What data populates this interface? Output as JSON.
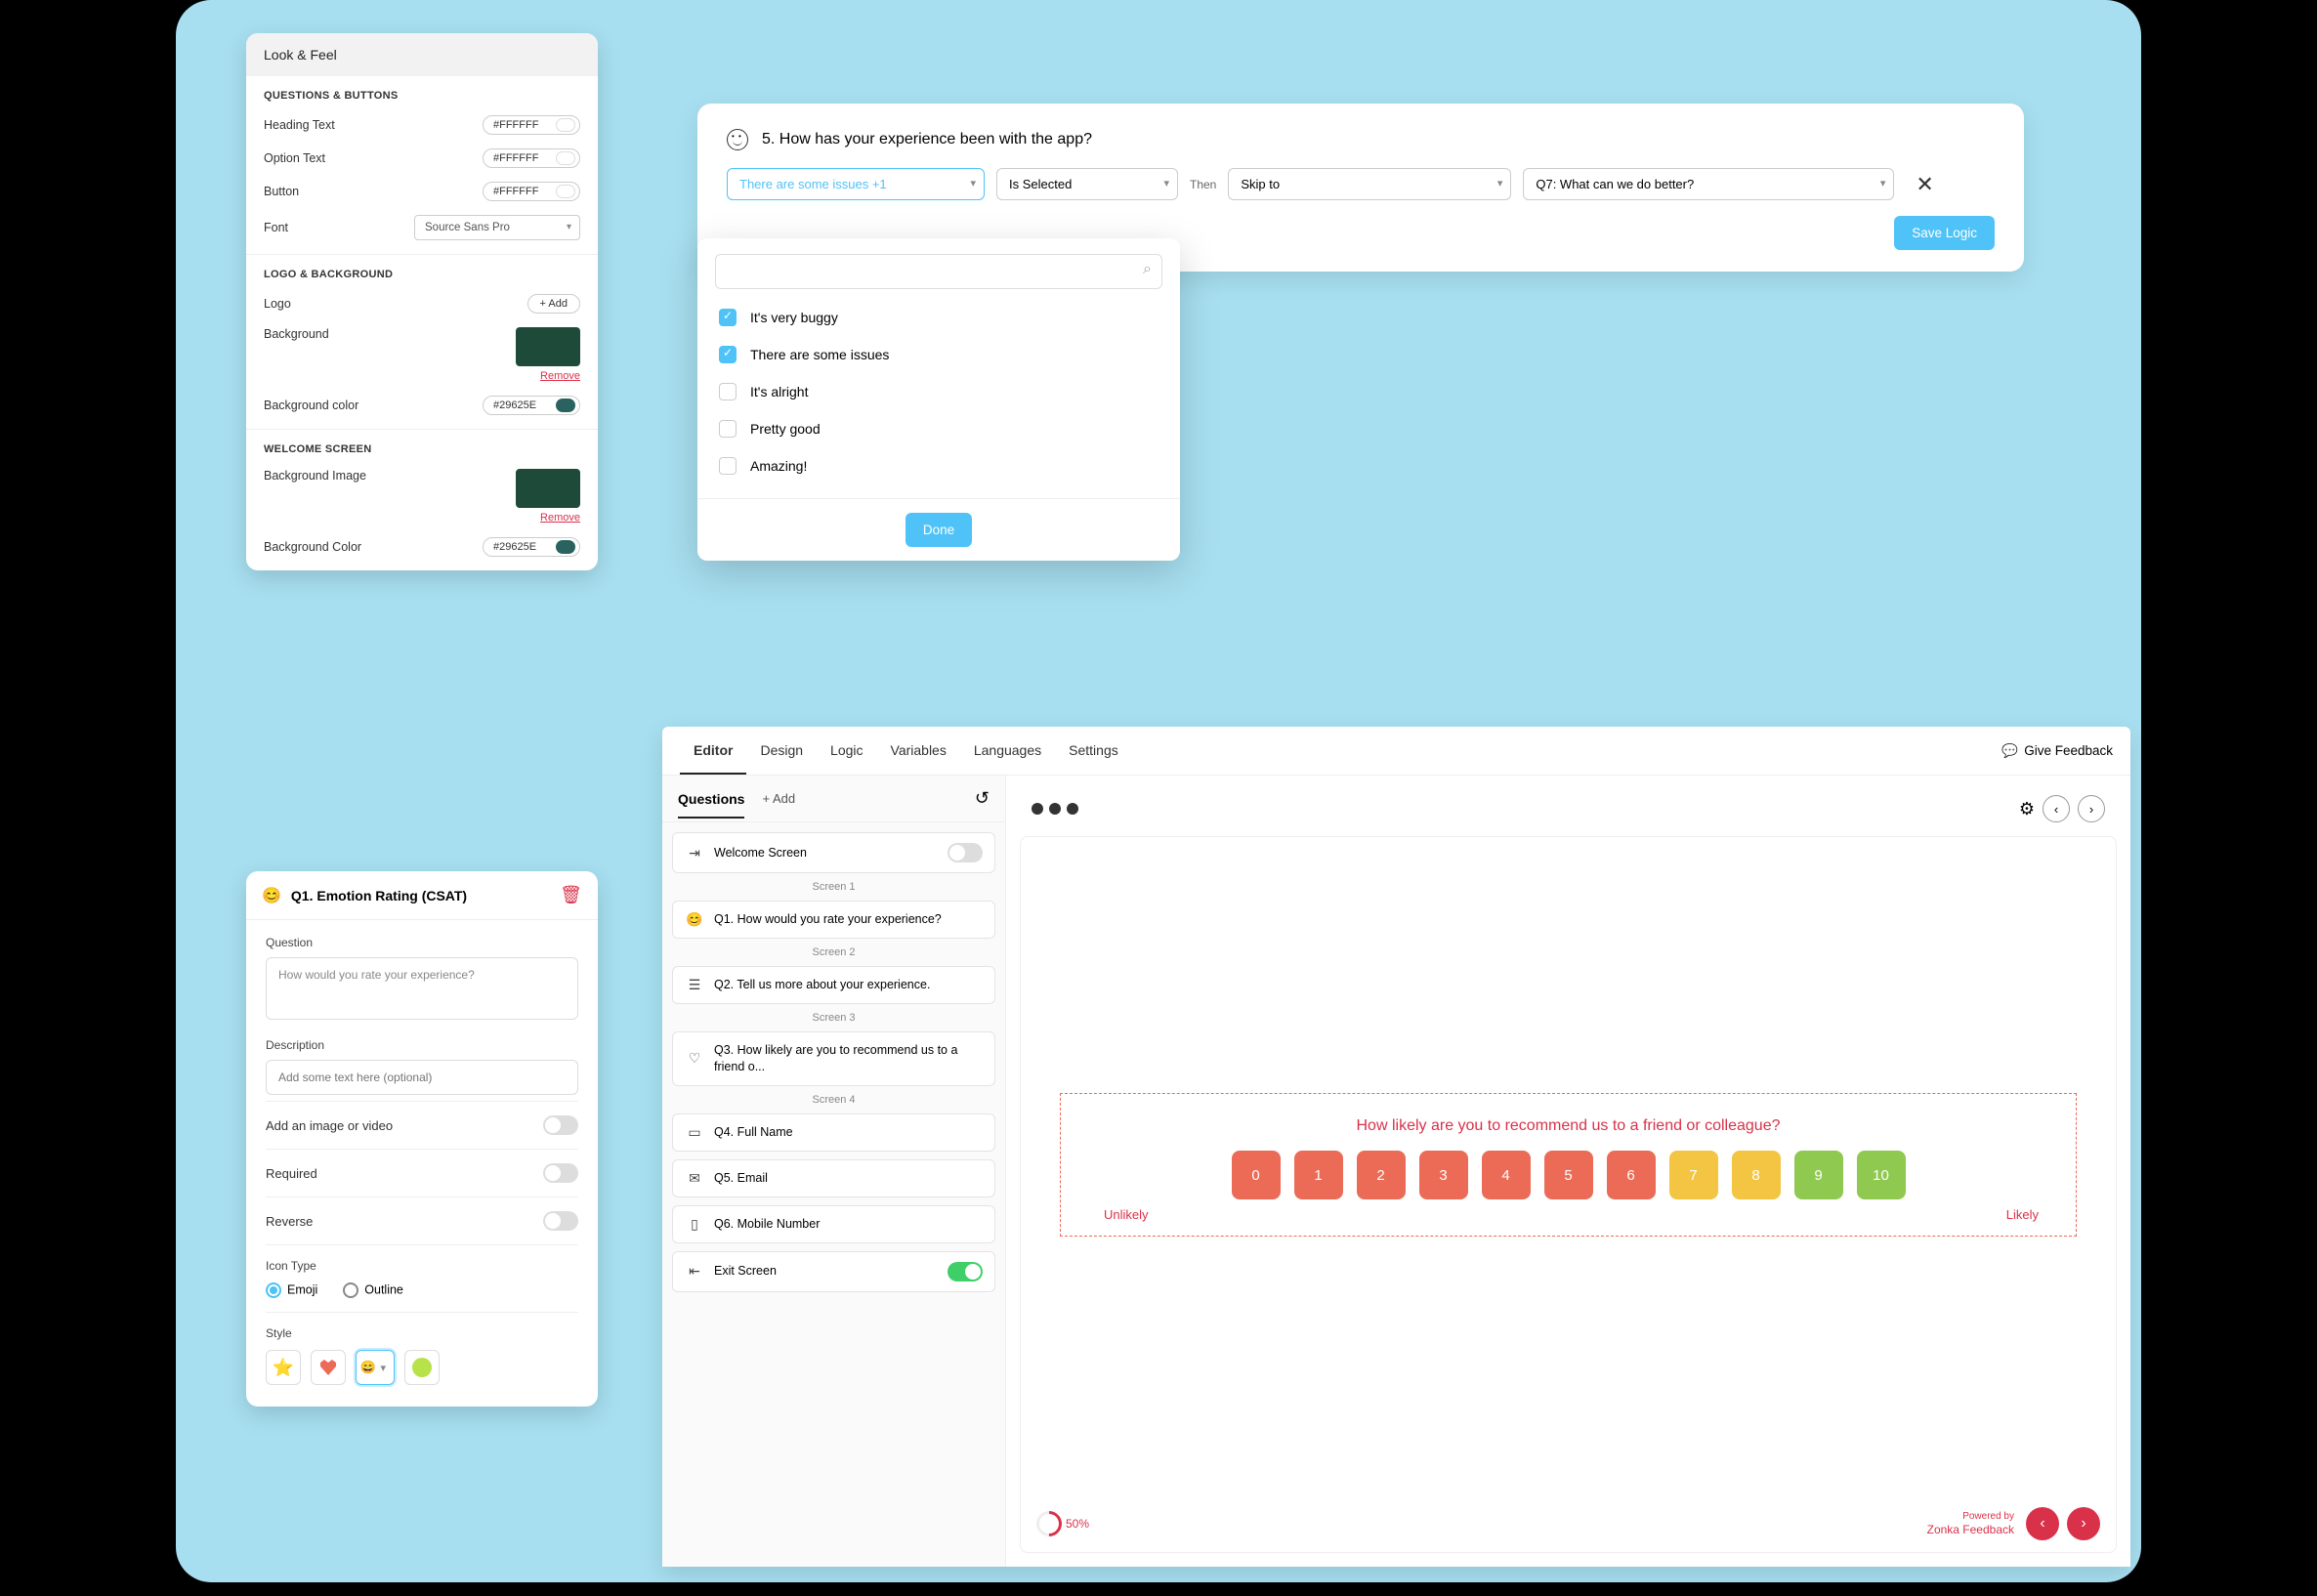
{
  "lookFeel": {
    "title": "Look & Feel",
    "sections": {
      "qb": {
        "title": "QUESTIONS & BUTTONS",
        "heading": {
          "label": "Heading Text",
          "value": "#FFFFFF",
          "color": "#ffffff"
        },
        "option": {
          "label": "Option Text",
          "value": "#FFFFFF",
          "color": "#ffffff"
        },
        "button": {
          "label": "Button",
          "value": "#FFFFFF",
          "color": "#ffffff"
        },
        "font": {
          "label": "Font",
          "value": "Source Sans Pro"
        }
      },
      "lb": {
        "title": "LOGO & BACKGROUND",
        "logo": {
          "label": "Logo",
          "action": "+ Add"
        },
        "bg": {
          "label": "Background",
          "remove": "Remove"
        },
        "bgcolor": {
          "label": "Background color",
          "value": "#29625E",
          "color": "#29625E"
        }
      },
      "ws": {
        "title": "WELCOME SCREEN",
        "bgimg": {
          "label": "Background Image",
          "remove": "Remove"
        },
        "bgcolor": {
          "label": "Background Color",
          "value": "#29625E",
          "color": "#29625E"
        }
      }
    }
  },
  "emotion": {
    "title": "Q1. Emotion Rating (CSAT)",
    "questionLabel": "Question",
    "questionValue": "How would you rate your experience?",
    "descLabel": "Description",
    "descPlaceholder": "Add some text here (optional)",
    "rows": {
      "image": "Add an image or video",
      "required": "Required",
      "reverse": "Reverse"
    },
    "iconTypeLabel": "Icon Type",
    "iconTypes": {
      "emoji": "Emoji",
      "outline": "Outline"
    },
    "styleLabel": "Style"
  },
  "logic": {
    "question": "5. How has your experience been with the app?",
    "condition": "There are some issues +1",
    "operator": "Is Selected",
    "then": "Then",
    "action": "Skip to",
    "target": "Q7: What can we do better?",
    "saveLabel": "Save Logic",
    "options": [
      {
        "label": "It's very buggy",
        "checked": true
      },
      {
        "label": "There are some issues",
        "checked": true
      },
      {
        "label": "It's alright",
        "checked": false
      },
      {
        "label": "Pretty good",
        "checked": false
      },
      {
        "label": "Amazing!",
        "checked": false
      }
    ],
    "doneLabel": "Done"
  },
  "editor": {
    "tabs": [
      "Editor",
      "Design",
      "Logic",
      "Variables",
      "Languages",
      "Settings"
    ],
    "activeTab": 0,
    "feedback": "Give Feedback",
    "questionsTab": "Questions",
    "addLabel": "+ Add",
    "items": {
      "welcome": "Welcome Screen",
      "s1": "Screen 1",
      "q1": "Q1. How would you rate your experience?",
      "s2": "Screen 2",
      "q2": "Q2. Tell us more about your experience.",
      "s3": "Screen 3",
      "q3": "Q3. How likely are you to recommend us to a friend o...",
      "s4": "Screen 4",
      "q4": "Q4. Full Name",
      "q5": "Q5. Email",
      "q6": "Q6. Mobile Number",
      "exit": "Exit Screen"
    }
  },
  "preview": {
    "npsQuestion": "How likely are you to recommend us to a friend or colleague?",
    "unlikely": "Unlikely",
    "likely": "Likely",
    "progress": "50%",
    "poweredLine1": "Powered by",
    "poweredLine2": "Zonka Feedback",
    "nps": [
      {
        "n": "0",
        "c": "#ec6b56"
      },
      {
        "n": "1",
        "c": "#ec6b56"
      },
      {
        "n": "2",
        "c": "#ec6b56"
      },
      {
        "n": "3",
        "c": "#ec6b56"
      },
      {
        "n": "4",
        "c": "#ec6b56"
      },
      {
        "n": "5",
        "c": "#ec6b56"
      },
      {
        "n": "6",
        "c": "#ec6b56"
      },
      {
        "n": "7",
        "c": "#f4c542"
      },
      {
        "n": "8",
        "c": "#f4c542"
      },
      {
        "n": "9",
        "c": "#8fc94f"
      },
      {
        "n": "10",
        "c": "#8fc94f"
      }
    ]
  }
}
